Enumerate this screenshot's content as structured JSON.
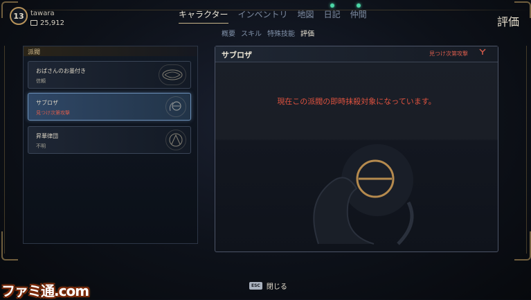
{
  "player": {
    "level": "13",
    "name": "tawara",
    "money": "25,912"
  },
  "nav": {
    "tabs": [
      {
        "label": "キャラクター",
        "active": true,
        "notification": false
      },
      {
        "label": "インベントリ",
        "active": false,
        "notification": false
      },
      {
        "label": "地図",
        "active": false,
        "notification": false
      },
      {
        "label": "日記",
        "active": false,
        "notification": true
      },
      {
        "label": "仲間",
        "active": false,
        "notification": true
      }
    ],
    "subtabs": [
      {
        "label": "概要",
        "active": false
      },
      {
        "label": "スキル",
        "active": false
      },
      {
        "label": "特殊技能",
        "active": false
      },
      {
        "label": "評価",
        "active": true
      }
    ]
  },
  "page_title": "評価",
  "factions_panel": {
    "header": "派閥",
    "items": [
      {
        "name": "おばさんのお墨付き",
        "status": "信頼",
        "hostile": false,
        "selected": false,
        "emblem": "scroll-emblem-icon"
      },
      {
        "name": "サブロザ",
        "status": "見つけ次第攻撃",
        "hostile": true,
        "selected": true,
        "emblem": "sabroza-emblem-icon"
      },
      {
        "name": "昇華律団",
        "status": "不明",
        "hostile": false,
        "selected": false,
        "emblem": "ascension-emblem-icon"
      }
    ]
  },
  "detail": {
    "title": "サブロザ",
    "status": "見つけ次第攻撃",
    "message": "現在この派閥の即時抹殺対象になっています。"
  },
  "footer": {
    "key": "ESC",
    "close_label": "閉じる"
  },
  "watermark": "ファミ通.com",
  "colors": {
    "accent_gold": "#b7935a",
    "hostile_red": "#d85c4c",
    "notification_green": "#4bd6a6",
    "selected_blue": "#6b8fb7"
  }
}
